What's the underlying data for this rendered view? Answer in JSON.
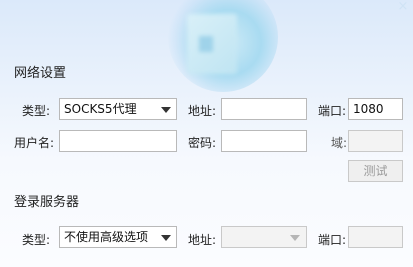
{
  "network": {
    "title": "网络设置",
    "type_label": "类型:",
    "type_value": "SOCKS5代理",
    "address_label": "地址:",
    "address_value": "",
    "port_label": "端口:",
    "port_value": "1080",
    "username_label": "用户名:",
    "username_value": "",
    "password_label": "密码:",
    "password_value": "",
    "domain_label": "域:",
    "domain_value": "",
    "test_button": "测试"
  },
  "login_server": {
    "title": "登录服务器",
    "type_label": "类型:",
    "type_value": "不使用高级选项",
    "address_label": "地址:",
    "address_value": "",
    "port_label": "端口:",
    "port_value": ""
  },
  "window": {
    "close_glyph": "×"
  }
}
